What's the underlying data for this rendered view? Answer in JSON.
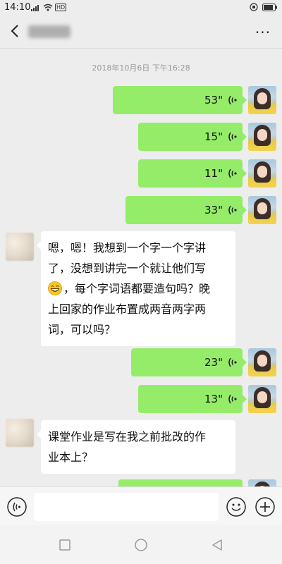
{
  "status_bar": {
    "time": "14:10",
    "network_badge": "HD",
    "icons": [
      "alarm-icon",
      "battery-icon"
    ]
  },
  "header": {
    "title": "",
    "back_icon": "chevron-left-icon",
    "more_label": "···"
  },
  "chat": {
    "timestamp": "2018年10月6日 下午16:28",
    "messages": [
      {
        "from": "me",
        "type": "voice",
        "duration": "53\""
      },
      {
        "from": "me",
        "type": "voice",
        "duration": "15\""
      },
      {
        "from": "me",
        "type": "voice",
        "duration": "11\""
      },
      {
        "from": "me",
        "type": "voice",
        "duration": "33\""
      },
      {
        "from": "other",
        "type": "text",
        "lines": [
          "嗯，嗯！我想到一个字一个字讲",
          "了，没想到讲完一个就让他们写",
          "，每个字词语都要造句吗？晚",
          "上回家的作业布置成两音两字两",
          "词，可以吗？"
        ],
        "emoji": "grin-emoji"
      },
      {
        "from": "me",
        "type": "voice",
        "duration": "23\""
      },
      {
        "from": "me",
        "type": "voice",
        "duration": "13\""
      },
      {
        "from": "other",
        "type": "text",
        "lines": [
          "课堂作业是写在我之前批改的作",
          "业本上？"
        ]
      }
    ]
  },
  "input_bar": {
    "placeholder": "",
    "value": ""
  },
  "colors": {
    "background": "#ededed",
    "my_bubble": "#95ec69",
    "other_bubble": "#ffffff"
  }
}
